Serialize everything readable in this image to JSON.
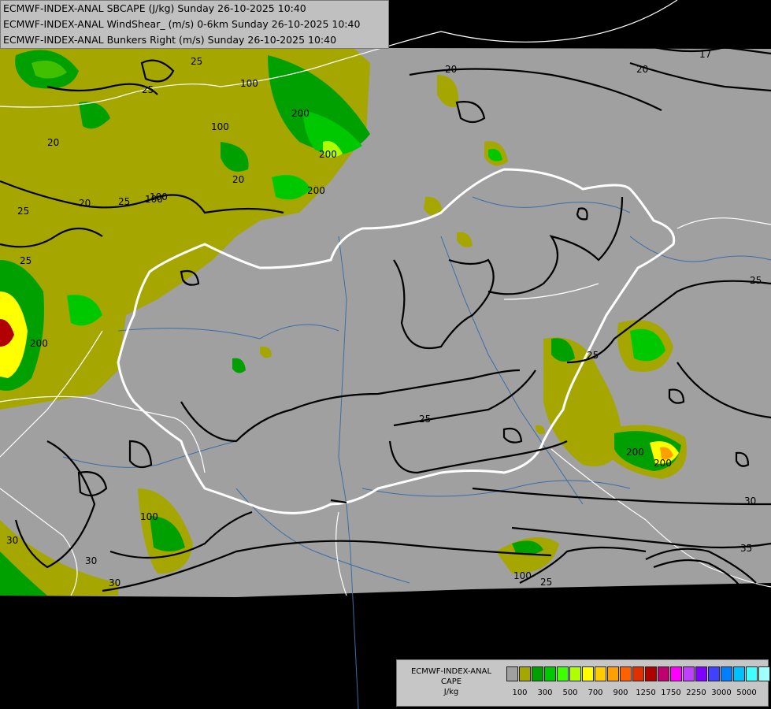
{
  "header": {
    "lines": [
      "ECMWF-INDEX-ANAL SBCAPE (J/kg) Sunday 26-10-2025 10:40",
      "ECMWF-INDEX-ANAL WindShear_ (m/s) 0-6km Sunday 26-10-2025 10:40",
      "ECMWF-INDEX-ANAL Bunkers Right (m/s) Sunday 26-10-2025 10:40"
    ]
  },
  "legend": {
    "title_lines": [
      "ECMWF-INDEX-ANAL",
      "CAPE",
      "J/kg"
    ],
    "swatch_colors": [
      "#a0a0a0",
      "#a6a600",
      "#00a000",
      "#00c800",
      "#40ff00",
      "#b0ff00",
      "#ffff00",
      "#ffcc00",
      "#ffa000",
      "#ff6000",
      "#e03000",
      "#b00000",
      "#c00070",
      "#ff00ff",
      "#c040ff",
      "#8000ff",
      "#4040ff",
      "#0080ff",
      "#00c0ff",
      "#40ffff",
      "#a0ffff",
      "#ffffff"
    ],
    "tick_labels": [
      "100",
      "300",
      "500",
      "700",
      "900",
      "1250",
      "1750",
      "2250",
      "3000",
      "5000"
    ]
  },
  "map_labels": {
    "contours": [
      "25",
      "20",
      "17",
      "20",
      "100",
      "200",
      "20",
      "200",
      "25",
      "100",
      "100",
      "200",
      "20",
      "25",
      "20",
      "25",
      "25",
      "100",
      "25",
      "200",
      "30",
      "100",
      "25",
      "30",
      "35",
      "25",
      "30",
      "30",
      "25",
      "100",
      "200",
      "25",
      "200"
    ]
  },
  "colors": {
    "background": "#000000",
    "land_gray": "#a0a0a0",
    "cape_100": "#a6a600",
    "cape_300": "#00a000",
    "cape_500": "#00c800",
    "cape_700": "#ffff00",
    "border_white": "#ffffff",
    "river_blue": "#3a6ea5"
  }
}
